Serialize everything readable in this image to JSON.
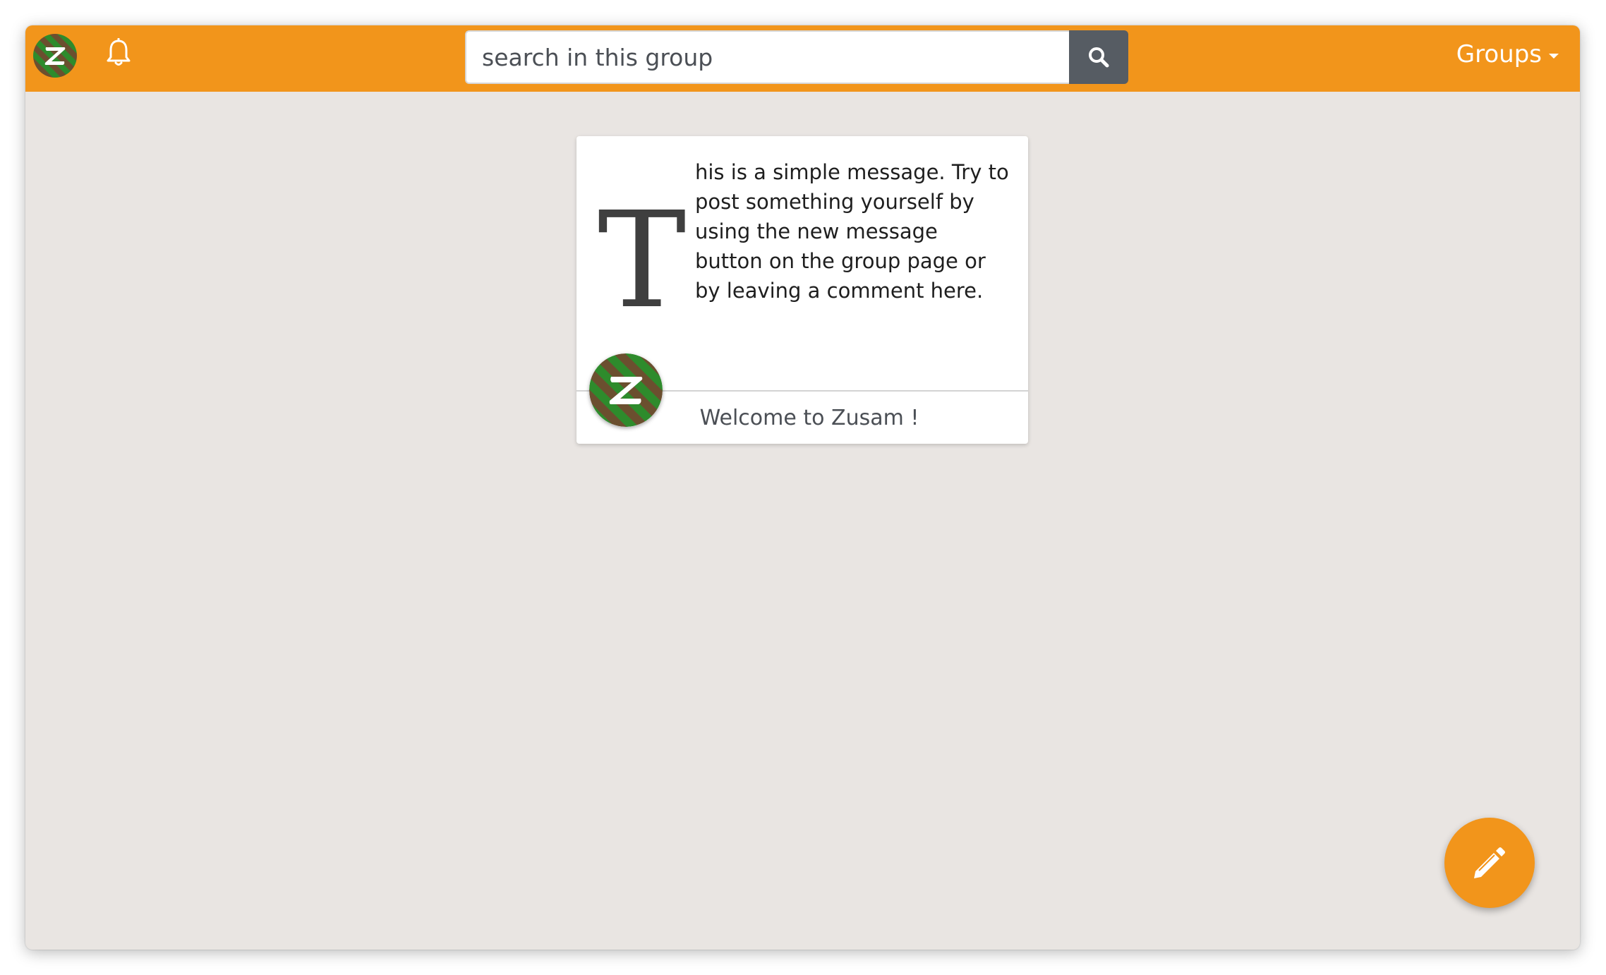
{
  "navbar": {
    "logo_icon": "zusam-logo-icon",
    "notifications_icon": "bell-icon",
    "search": {
      "placeholder": "search in this group",
      "button_icon": "search-icon"
    },
    "groups_label": "Groups",
    "groups_caret_icon": "caret-down-icon"
  },
  "message_card": {
    "drop_cap": "T",
    "text": "his is a simple message. Try to post something yourself by using the new message button on the group page or by leaving a comment here.",
    "author_avatar_icon": "zusam-logo-icon",
    "title": "Welcome to Zusam !"
  },
  "new_message_button": {
    "icon": "pencil-icon"
  },
  "colors": {
    "navbar_orange": "#f2951b",
    "page_background": "#e9e5e2",
    "search_button": "#565c63",
    "logo_green": "#2e8b2c",
    "logo_brown": "#6b4f2f"
  }
}
